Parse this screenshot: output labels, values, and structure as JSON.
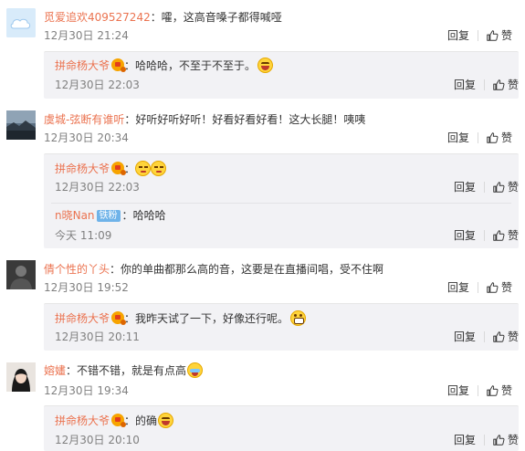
{
  "labels": {
    "reply": "回复",
    "like": "赞",
    "separator": "："
  },
  "colors": {
    "username": "#eb7350",
    "meta": "#808080",
    "reply_bg": "#f2f2f5",
    "badge": "#6fb3e9"
  },
  "comments": [
    {
      "user": "觅爱追欢409527242",
      "text": "嚯，这高音嗓子都得喊哑",
      "time": "12月30日 21:24",
      "avatar": "default-cloud-avatar",
      "replies": [
        {
          "user": "拼命杨大爷",
          "text": "哈哈哈，不至于不至于。",
          "emoji": "laugh",
          "time": "12月30日 22:03"
        }
      ]
    },
    {
      "user": "虞城-弦断有谁听",
      "text": "好听好听好听！好看好看好看！这大长腿！咦咦",
      "time": "12月30日 20:34",
      "avatar": "landscape-avatar",
      "replies": [
        {
          "user": "拼命杨大爷",
          "text": "",
          "emoji": "meh-meh",
          "time": "12月30日 22:03"
        },
        {
          "user": "n晓Nan",
          "badge": "铁粉",
          "text": "哈哈哈",
          "time": "今天 11:09"
        }
      ]
    },
    {
      "user": "倩个性的丫头",
      "text": "你的单曲都那么高的音，这要是在直播间唱，受不住啊",
      "time": "12月30日 19:52",
      "avatar": "dark-photo-avatar",
      "replies": [
        {
          "user": "拼命杨大爷",
          "text": "我昨天试了一下，好像还行呢。",
          "emoji": "grin",
          "time": "12月30日 20:11"
        }
      ]
    },
    {
      "user": "嫆嫿",
      "text": "不错不错，就是有点高",
      "emoji": "cry",
      "time": "12月30日 19:34",
      "avatar": "portrait-avatar",
      "replies": [
        {
          "user": "拼命杨大爷",
          "text": "的确",
          "emoji": "laugh",
          "time": "12月30日 20:10"
        }
      ]
    }
  ]
}
